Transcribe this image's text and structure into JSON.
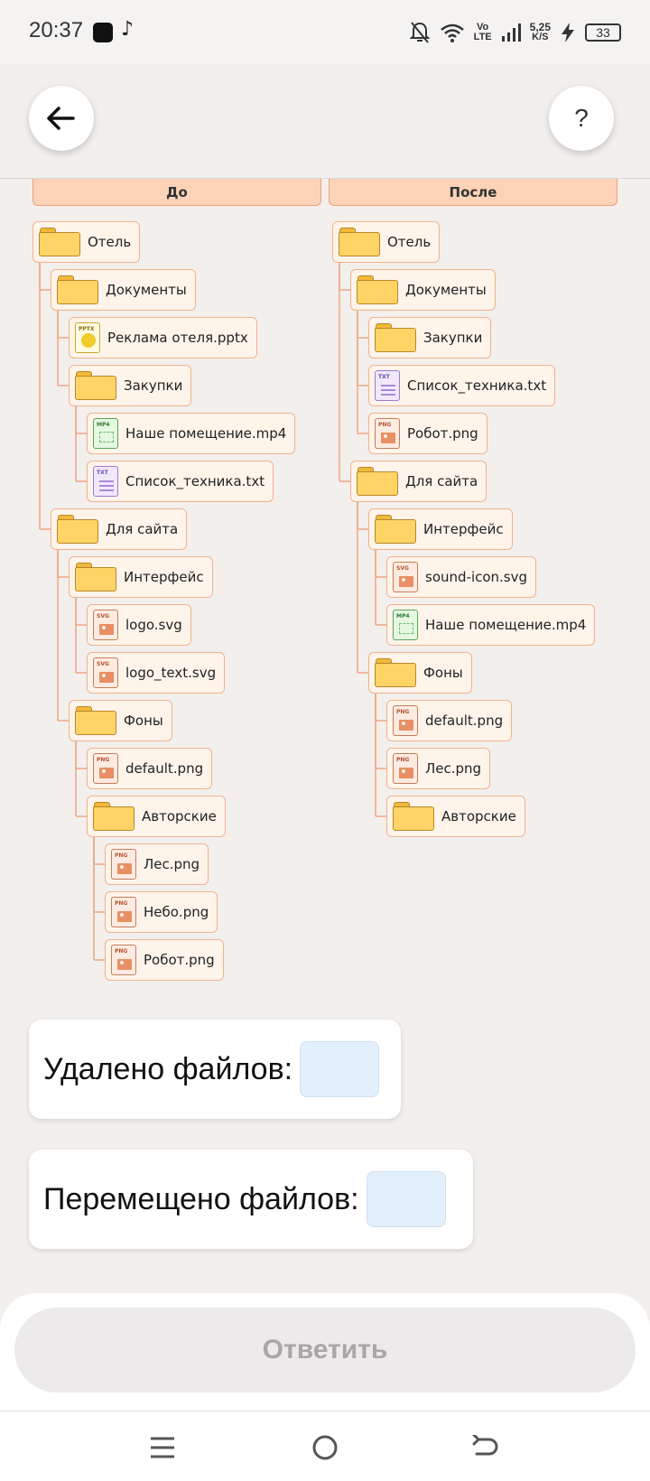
{
  "status_bar": {
    "time": "20:37",
    "volte_top": "Vo",
    "volte_bottom": "LTE",
    "speed_value": "5,25",
    "speed_unit": "K/S",
    "battery": "33",
    "icons": [
      "app-square-icon",
      "tiktok-icon",
      "mute-icon",
      "wifi-icon",
      "signal-icon",
      "charging-icon",
      "battery-icon"
    ]
  },
  "header": {
    "back_icon": "arrow-left-icon",
    "help_label": "?"
  },
  "columns": {
    "before": "До",
    "after": "После"
  },
  "tree_before": [
    {
      "label": "Отель",
      "type": "folder",
      "depth": 0
    },
    {
      "label": "Документы",
      "type": "folder",
      "depth": 1
    },
    {
      "label": "Реклама отеля.pptx",
      "type": "pptx",
      "depth": 2
    },
    {
      "label": "Закупки",
      "type": "folder",
      "depth": 2
    },
    {
      "label": "Наше помещение.mp4",
      "type": "mp4",
      "depth": 3
    },
    {
      "label": "Список_техника.txt",
      "type": "txt",
      "depth": 3
    },
    {
      "label": "Для сайта",
      "type": "folder",
      "depth": 1
    },
    {
      "label": "Интерфейс",
      "type": "folder",
      "depth": 2
    },
    {
      "label": "logo.svg",
      "type": "svg",
      "depth": 3
    },
    {
      "label": "logo_text.svg",
      "type": "svg",
      "depth": 3
    },
    {
      "label": "Фоны",
      "type": "folder",
      "depth": 2
    },
    {
      "label": "default.png",
      "type": "png",
      "depth": 3
    },
    {
      "label": "Авторские",
      "type": "folder",
      "depth": 3
    },
    {
      "label": "Лес.png",
      "type": "png",
      "depth": 4
    },
    {
      "label": "Небо.png",
      "type": "png",
      "depth": 4
    },
    {
      "label": "Робот.png",
      "type": "png",
      "depth": 4
    }
  ],
  "tree_after": [
    {
      "label": "Отель",
      "type": "folder",
      "depth": 0
    },
    {
      "label": "Документы",
      "type": "folder",
      "depth": 1
    },
    {
      "label": "Закупки",
      "type": "folder",
      "depth": 2
    },
    {
      "label": "Список_техника.txt",
      "type": "txt",
      "depth": 2
    },
    {
      "label": "Робот.png",
      "type": "png",
      "depth": 2
    },
    {
      "label": "Для сайта",
      "type": "folder",
      "depth": 1
    },
    {
      "label": "Интерфейс",
      "type": "folder",
      "depth": 2
    },
    {
      "label": "sound-icon.svg",
      "type": "svg",
      "depth": 3
    },
    {
      "label": "Наше помещение.mp4",
      "type": "mp4",
      "depth": 3
    },
    {
      "label": "Фоны",
      "type": "folder",
      "depth": 2
    },
    {
      "label": "default.png",
      "type": "png",
      "depth": 3
    },
    {
      "label": "Лес.png",
      "type": "png",
      "depth": 3
    },
    {
      "label": "Авторские",
      "type": "folder",
      "depth": 3
    }
  ],
  "file_tags": {
    "pptx": "PPTX",
    "mp4": "MP4",
    "txt": "TXT",
    "svg": "SVG",
    "png": "PNG"
  },
  "questions": {
    "deleted_label": "Удалено файлов:",
    "deleted_value": "",
    "moved_label": "Перемещено файлов:",
    "moved_value": ""
  },
  "answer_button": "Ответить",
  "nav_icons": [
    "menu-icon",
    "home-icon",
    "back-icon"
  ]
}
